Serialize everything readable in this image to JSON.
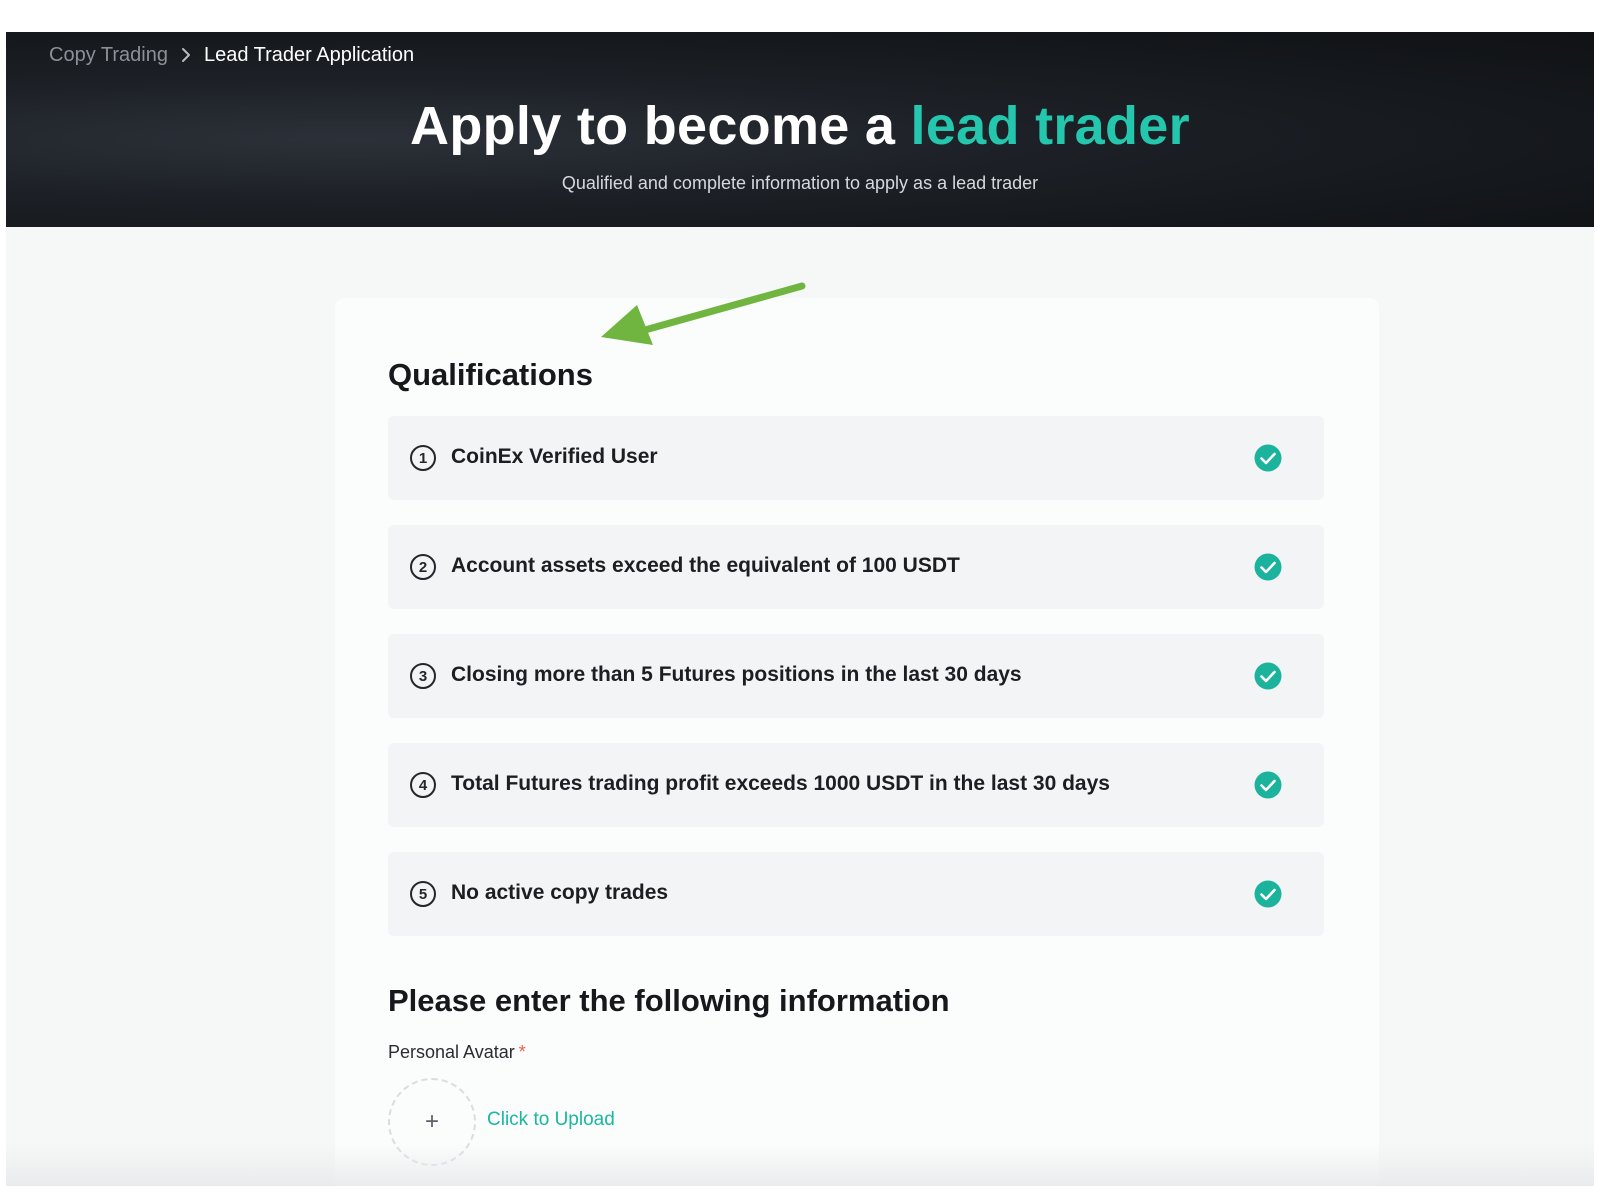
{
  "breadcrumb": {
    "parent": "Copy Trading",
    "current": "Lead Trader Application"
  },
  "hero": {
    "title_main": "Apply to become a ",
    "title_accent": "lead trader",
    "subtitle": "Qualified and complete information to apply as a lead trader"
  },
  "qualifications": {
    "title": "Qualifications",
    "items": [
      {
        "number": "1",
        "text": "CoinEx Verified User",
        "met": true
      },
      {
        "number": "2",
        "text": "Account assets exceed the equivalent of 100 USDT",
        "met": true
      },
      {
        "number": "3",
        "text": "Closing more than 5 Futures positions in the last 30 days",
        "met": true
      },
      {
        "number": "4",
        "text": "Total Futures trading profit exceeds 1000 USDT in the last 30 days",
        "met": true
      },
      {
        "number": "5",
        "text": "No active copy trades",
        "met": true
      }
    ]
  },
  "info": {
    "title": "Please enter the following information",
    "avatar_label": "Personal Avatar",
    "required_mark": "*",
    "upload_plus": "+",
    "upload_link": "Click to Upload"
  },
  "colors": {
    "accent": "#24c7ad",
    "check": "#1bb39b",
    "annotation_arrow": "#6fb53f",
    "required": "#ef5a4b"
  },
  "icons": {
    "breadcrumb_separator": "chevron-right-icon",
    "qualification_status": "check-circle-icon",
    "annotation": "arrow-annotation"
  }
}
